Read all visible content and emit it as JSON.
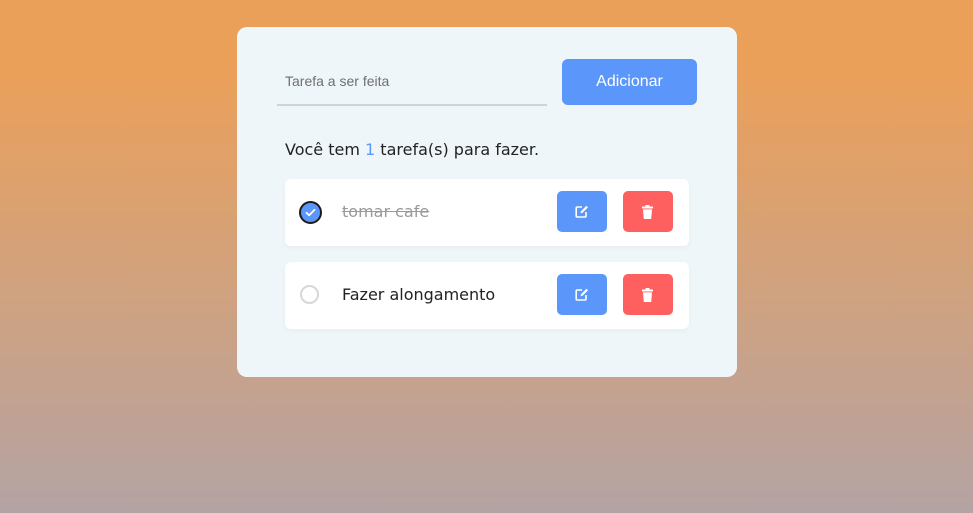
{
  "form": {
    "input_placeholder": "Tarefa a ser feita",
    "input_value": "",
    "add_label": "Adicionar"
  },
  "summary": {
    "prefix": "Você tem",
    "count": "1",
    "suffix": "tarefa(s) para fazer."
  },
  "tasks": [
    {
      "label": "tomar cafe",
      "completed": true
    },
    {
      "label": "Fazer alongamento",
      "completed": false
    }
  ],
  "icons": {
    "check": "check-icon",
    "edit": "edit-icon",
    "delete": "trash-icon"
  },
  "colors": {
    "accent": "#5b96fa",
    "danger": "#fe5f5f",
    "card": "#eff6f9",
    "bg_top": "#eba05a",
    "bg_bottom": "#b4a3a4"
  }
}
